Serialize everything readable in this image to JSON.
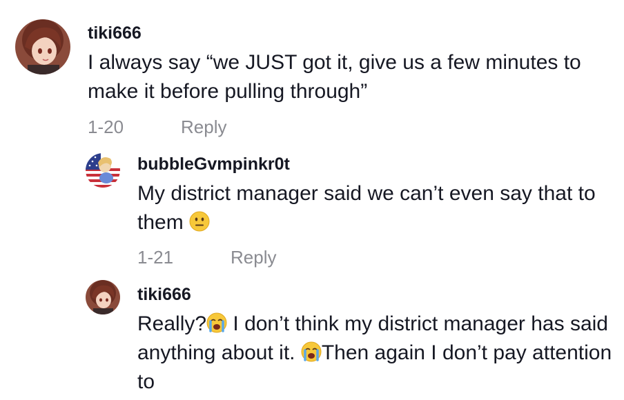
{
  "comments": [
    {
      "username": "tiki666",
      "text": "I always say “we JUST got it, give us a few minutes to make it before pulling through”",
      "date": "1-20",
      "reply_label": "Reply",
      "avatar": "anime-girl-avatar"
    },
    {
      "username": "bubbleGvmpinkr0t",
      "text_part1": "My district manager said we can’t even say that to them ",
      "emoji": "neutral-face",
      "date": "1-21",
      "reply_label": "Reply",
      "avatar": "flag-anime-avatar"
    },
    {
      "username": "tiki666",
      "text_part1": "Really?",
      "emoji1": "loudly-crying-face",
      "text_part2": " I don’t think my district manager has said anything about it. ",
      "emoji2": "loudly-crying-face",
      "text_part3": "Then again I don’t pay attention to",
      "avatar": "anime-girl-avatar"
    }
  ]
}
